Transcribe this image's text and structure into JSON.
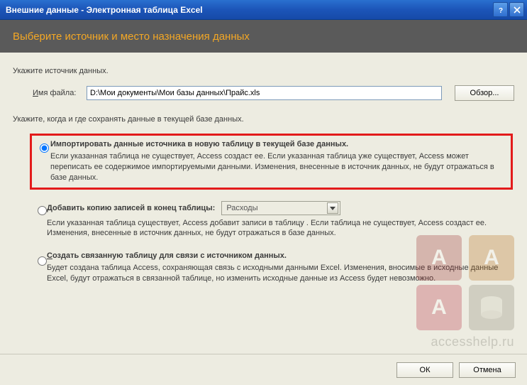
{
  "window": {
    "title": "Внешние данные - Электронная таблица Excel"
  },
  "header": {
    "title": "Выберите источник и место назначения данных"
  },
  "source": {
    "prompt": "Укажите источник данных.",
    "file_label_pre": "И",
    "file_label_rest": "мя файла:",
    "file_value": "D:\\Мои документы\\Мои базы данных\\Прайс.xls",
    "browse": "Обзор..."
  },
  "dest": {
    "prompt": "Укажите, когда и где сохранять данные в текущей базе данных."
  },
  "options": [
    {
      "id": "import",
      "checked": true,
      "label": "Импортировать данные источника в новую таблицу в текущей базе данных.",
      "desc": "Если указанная таблица не существует, Access создаст ее. Если указанная таблица уже существует, Access может переписать ее содержимое импортируемыми данными. Изменения, внесенные в источник данных, не будут отражаться в базе данных."
    },
    {
      "id": "append",
      "checked": false,
      "label_pre": "Д",
      "label_rest": "обавить копию записей в конец таблицы:",
      "combo_value": "Расходы",
      "desc": "Если указанная таблица существует, Access добавит записи в таблицу . Если таблица не существует, Access создаст ее. Изменения, внесенные в источник данных, не будут отражаться в базе данных."
    },
    {
      "id": "link",
      "checked": false,
      "label_pre": "С",
      "label_rest": "оздать связанную таблицу для связи с источником данных.",
      "desc": "Будет создана таблица Access, сохраняющая связь с исходными данными Excel. Изменения, вносимые в исходные данные Excel, будут отражаться в связанной таблице, но изменить исходные данные из Access будет невозможно."
    }
  ],
  "footer": {
    "ok": "ОК",
    "cancel": "Отмена"
  },
  "watermark": "accesshelp.ru"
}
